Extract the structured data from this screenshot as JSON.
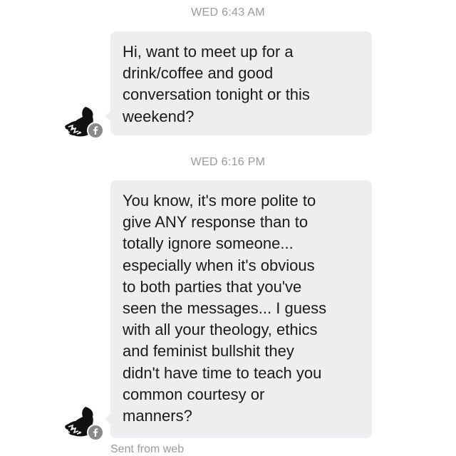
{
  "conversation": {
    "messages": [
      {
        "timestamp": "WED 6:43 AM",
        "text": "Hi, want to meet up for a\ndrink/coffee and good\nconversation tonight or  this\nweekend?",
        "avatar_icon": "sender-avatar",
        "badge_icon": "facebook-icon"
      },
      {
        "timestamp": "WED 6:16 PM",
        "text": "You know, it's more polite to\ngive ANY response than to\ntotally ignore someone...\nespecially when it's obvious\nto both parties that you've\nseen the messages... I guess\nwith all your theology, ethics\nand feminist bullshit they\ndidn't have time to teach you\ncommon courtesy or\nmanners?",
        "avatar_icon": "sender-avatar",
        "badge_icon": "facebook-icon"
      }
    ],
    "footer": "Sent from web"
  },
  "colors": {
    "bubble_background": "#eeeef0",
    "timestamp_text": "#9a9a9a",
    "message_text": "#1a1a1a"
  }
}
